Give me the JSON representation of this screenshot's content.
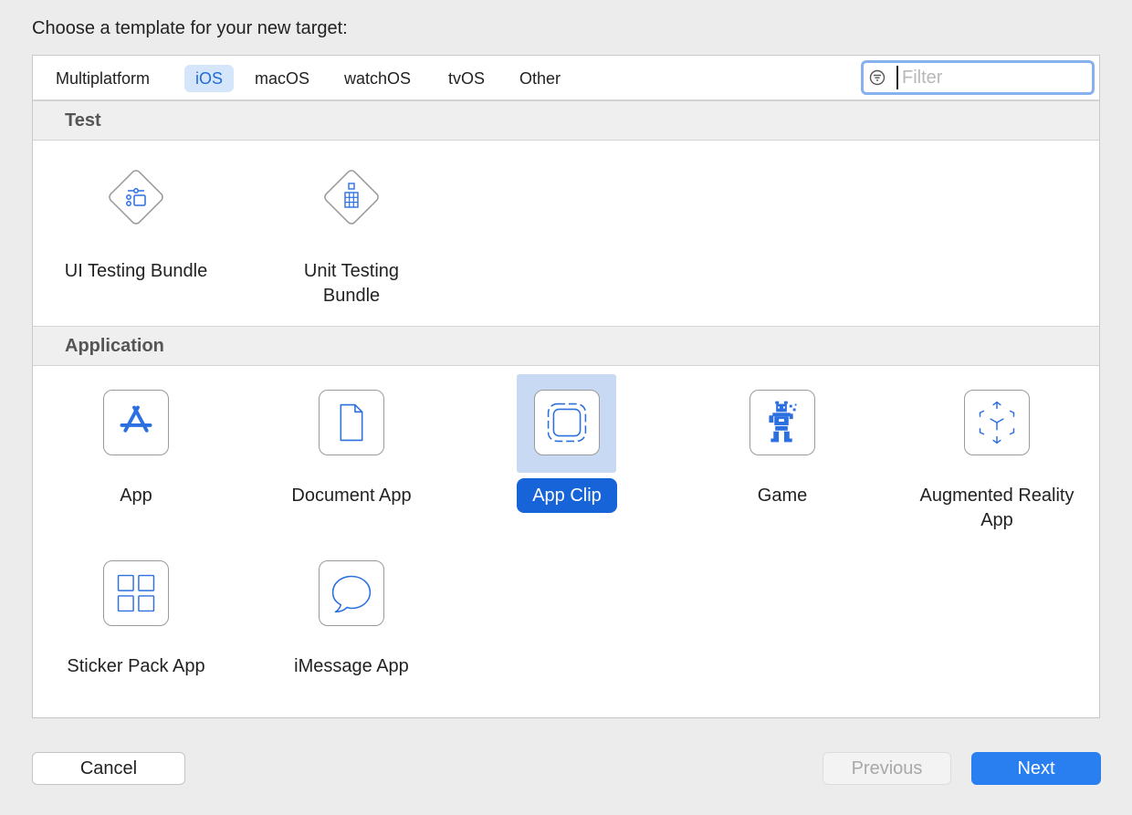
{
  "heading": "Choose a template for your new target:",
  "tabs": [
    "Multiplatform",
    "iOS",
    "macOS",
    "watchOS",
    "tvOS",
    "Other"
  ],
  "selected_tab": "iOS",
  "filter": {
    "placeholder": "Filter",
    "value": ""
  },
  "sections": [
    {
      "title": "Test",
      "items": [
        {
          "label": "UI Testing Bundle",
          "icon": "ui-testing-icon"
        },
        {
          "label": "Unit Testing Bundle",
          "icon": "unit-testing-icon"
        }
      ]
    },
    {
      "title": "Application",
      "items": [
        {
          "label": "App",
          "icon": "app-store-icon"
        },
        {
          "label": "Document App",
          "icon": "document-icon"
        },
        {
          "label": "App Clip",
          "icon": "app-clip-icon"
        },
        {
          "label": "Game",
          "icon": "game-sprite-icon"
        },
        {
          "label": "Augmented Reality App",
          "icon": "ar-cube-icon"
        },
        {
          "label": "Sticker Pack App",
          "icon": "sticker-grid-icon"
        },
        {
          "label": "iMessage App",
          "icon": "message-bubble-icon"
        }
      ]
    }
  ],
  "selected_item": "App Clip",
  "buttons": {
    "cancel": "Cancel",
    "previous": "Previous",
    "next": "Next"
  },
  "colors": {
    "accent": "#1764d8",
    "selection_bg": "#c8daf3",
    "tab_selected_bg": "#d5e6fb",
    "icon_blue": "#2b6fe0"
  }
}
